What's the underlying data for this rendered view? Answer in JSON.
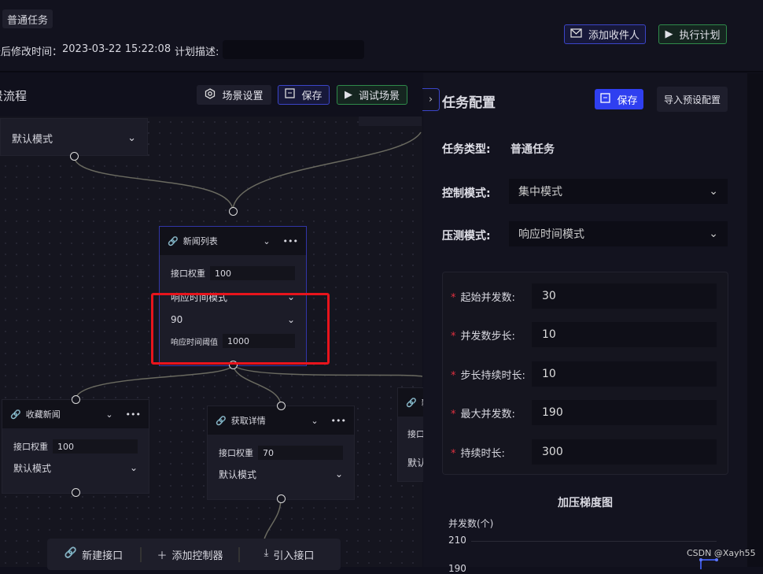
{
  "header": {
    "task_tag": "普通任务",
    "modified_label": "最后修改时间：",
    "modified_time": "2023-03-22 15:22:08",
    "desc_label": "计划描述:",
    "desc_value": "",
    "add_recipient": "添加收件人",
    "execute_plan": "执行计划"
  },
  "flow": {
    "title": "场景流程",
    "scene_settings": "场景设置",
    "save": "保存",
    "debug_scene": "调试场景",
    "top_node": {
      "mode": "默认模式"
    },
    "nodes": [
      {
        "name": "新闻列表",
        "weight_label": "接口权重",
        "weight": "100",
        "mode": "响应时间模式",
        "percentile": "90",
        "threshold_label": "响应时间阈值",
        "threshold": "1000"
      },
      {
        "name": "收藏新闻",
        "weight_label": "接口权重",
        "weight": "100",
        "mode": "默认模式"
      },
      {
        "name": "获取详情",
        "weight_label": "接口权重",
        "weight": "70",
        "mode": "默认模式"
      },
      {
        "name": "新",
        "weight_label": "接口",
        "mode": "默认"
      }
    ],
    "toolbar": {
      "new_api": "新建接口",
      "add_controller": "添加控制器",
      "import_api": "引入接口"
    }
  },
  "panel": {
    "title": "任务配置",
    "save": "保存",
    "import_preset": "导入预设配置",
    "task_type_label": "任务类型:",
    "task_type": "普通任务",
    "control_mode_label": "控制模式:",
    "control_mode": "集中模式",
    "stress_mode_label": "压测模式:",
    "stress_mode": "响应时间模式",
    "fields": [
      {
        "label": "起始并发数:",
        "value": "30"
      },
      {
        "label": "并发数步长:",
        "value": "10"
      },
      {
        "label": "步长持续时长:",
        "value": "10"
      },
      {
        "label": "最大并发数:",
        "value": "190"
      },
      {
        "label": "持续时长:",
        "value": "300"
      }
    ],
    "chart": {
      "title": "加压梯度图",
      "ylabel": "并发数(个)",
      "yticks": [
        "210",
        "190"
      ]
    }
  },
  "watermark": "CSDN @Xayh55",
  "colors": {
    "primary": "#2f3ff0",
    "success": "#2f8a4a",
    "highlight": "#e8141c"
  }
}
